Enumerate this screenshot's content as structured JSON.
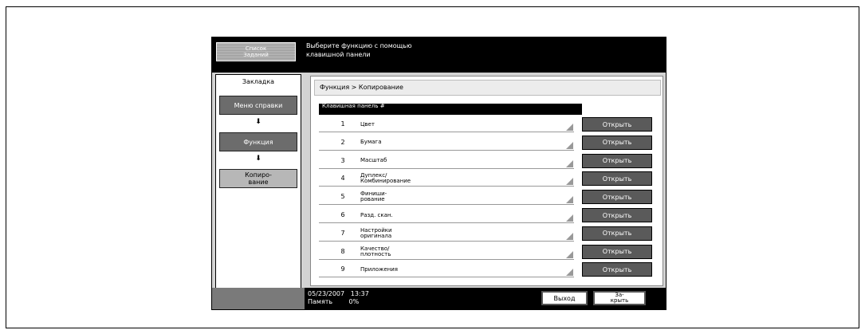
{
  "header": {
    "jobs_button": "Список\nЗаданий",
    "message": "Выберите функцию с помощью\nклавишной панели"
  },
  "sidebar": {
    "tab_title": "Закладка",
    "menu_button": "Меню справки",
    "function_button": "Функция",
    "copy_button": "Копиро-\nвание",
    "arrow": "⬇"
  },
  "breadcrumb": "Функция > Копирование",
  "list_header": "Клавишная панель\n#",
  "items": [
    {
      "num": "1",
      "label": "Цвет",
      "button": "Открыть"
    },
    {
      "num": "2",
      "label": "Бумага",
      "button": "Открыть"
    },
    {
      "num": "3",
      "label": "Масштаб",
      "button": "Открыть"
    },
    {
      "num": "4",
      "label": "Дуплекс/\nКомбинирование",
      "button": "Открыть"
    },
    {
      "num": "5",
      "label": "Финиши-\nрование",
      "button": "Открыть"
    },
    {
      "num": "6",
      "label": "Разд. скан.",
      "button": "Открыть"
    },
    {
      "num": "7",
      "label": "Настройки\nоригинала",
      "button": "Открыть"
    },
    {
      "num": "8",
      "label": "Качество/\nплотность",
      "button": "Открыть"
    },
    {
      "num": "9",
      "label": "Приложения",
      "button": "Открыть"
    }
  ],
  "footer": {
    "status": "05/23/2007   13:37\nПамять        0%",
    "exit_button": "Выход",
    "close_button": "За-\nкрыть"
  }
}
